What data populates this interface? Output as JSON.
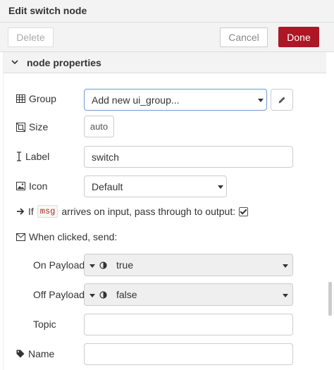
{
  "header": {
    "title": "Edit switch node"
  },
  "toolbar": {
    "delete_label": "Delete",
    "cancel_label": "Cancel",
    "done_label": "Done"
  },
  "section": {
    "label": "node properties"
  },
  "fields": {
    "group": {
      "label": "Group",
      "value": "Add new ui_group..."
    },
    "size": {
      "label": "Size",
      "value": "auto"
    },
    "label": {
      "label": "Label",
      "value": "switch"
    },
    "icon": {
      "label": "Icon",
      "value": "Default"
    },
    "passthrough": {
      "prefix": "If",
      "code": "msg",
      "suffix": "arrives on input, pass through to output:",
      "checked": true
    },
    "when_clicked": {
      "label": "When clicked, send:"
    },
    "on_payload": {
      "label": "On Payload",
      "value": "true"
    },
    "off_payload": {
      "label": "Off Payload",
      "value": "false"
    },
    "topic": {
      "label": "Topic",
      "value": ""
    },
    "name": {
      "label": "Name",
      "value": ""
    }
  },
  "colors": {
    "accent": "#ad1625",
    "panel": "#f3f3f3",
    "border": "#cccccc"
  }
}
